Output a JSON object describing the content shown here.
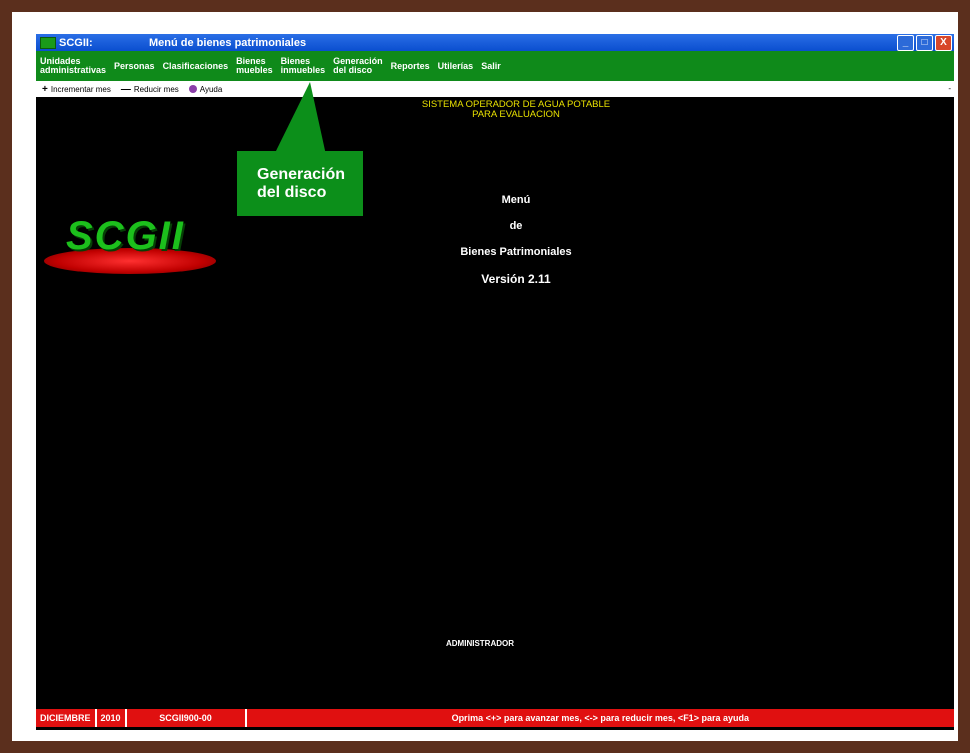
{
  "window": {
    "app_name": "SCGII:",
    "title": "Menú de bienes patrimoniales",
    "controls": [
      "_",
      "□",
      "X"
    ]
  },
  "menu": [
    {
      "label": "Unidades\nadministrativas"
    },
    {
      "label": "Personas"
    },
    {
      "label": "Clasificaciones"
    },
    {
      "label": "Bienes\nmuebles"
    },
    {
      "label": "Bienes\ninmuebles"
    },
    {
      "label": "Generación\ndel disco"
    },
    {
      "label": "Reportes"
    },
    {
      "label": "Utilerías"
    },
    {
      "label": "Salir"
    }
  ],
  "toolbar": {
    "increment_label": "Incrementar mes",
    "reduce_label": "Reducir mes",
    "help_label": "Ayuda",
    "right_marker": "-"
  },
  "header": {
    "line1": "SISTEMA OPERADOR DE AGUA POTABLE",
    "line2": "PARA EVALUACION"
  },
  "logo": {
    "text": "SCGII"
  },
  "callout": {
    "line1": "Generación",
    "line2": "del disco"
  },
  "center": {
    "line1": "Menú",
    "line2": "de",
    "line3": "Bienes Patrimoniales",
    "line4": "Versión 2.11"
  },
  "user": "ADMINISTRADOR",
  "status": {
    "month": "DICIEMBRE",
    "year": "2010",
    "code": "SCGII900-00",
    "message": "Oprima <+> para avanzar mes, <-> para reducir mes, <F1> para ayuda"
  },
  "colors": {
    "menu_bg": "#0f8a1a",
    "status_bg": "#e01010",
    "header_text": "#e8e000"
  },
  "icons": [
    "app-icon",
    "plus-icon",
    "minus-icon",
    "help-icon",
    "minimize-icon",
    "maximize-icon",
    "close-icon"
  ]
}
